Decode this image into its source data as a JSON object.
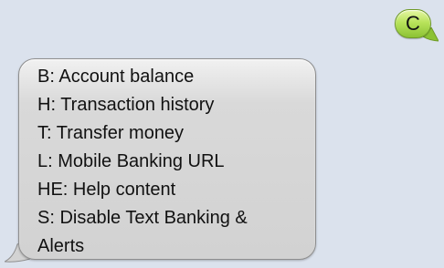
{
  "thread": {
    "sent_message": {
      "text": "C"
    },
    "received_message": {
      "lines": [
        "B: Account balance",
        "H: Transaction history",
        "T: Transfer money",
        "L: Mobile Banking URL",
        "HE: Help content",
        "S: Disable Text Banking &",
        "Alerts"
      ]
    }
  },
  "colors": {
    "background": "#dbe2ed",
    "sent_bubble": "#b8e35b",
    "received_bubble": "#d9d9d9"
  }
}
